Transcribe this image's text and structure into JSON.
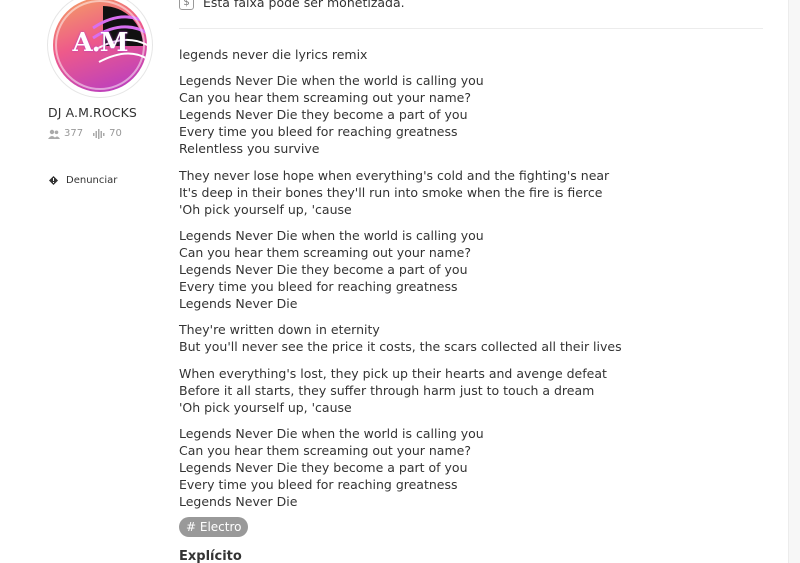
{
  "artist": {
    "avatar_text": "A.M",
    "name": "DJ A.M.ROCKS",
    "followers": "377",
    "tracks": "70",
    "report_label": "Denunciar"
  },
  "monetization": {
    "icon": "$",
    "text": "Esta faixa pode ser monetizada."
  },
  "lyrics": {
    "title": "legends never die lyrics remix",
    "stanzas": [
      [
        "Legends Never Die when the world is calling you",
        "Can you hear them screaming out your name?",
        "Legends Never Die they become a part of you",
        "Every time you bleed for reaching greatness",
        "Relentless you survive"
      ],
      [
        "They never lose hope when everything's cold and the fighting's near",
        "It's deep in their bones they'll run into smoke when the fire is fierce",
        "'Oh pick yourself up, 'cause"
      ],
      [
        "Legends Never Die when the world is calling you",
        "Can you hear them screaming out your name?",
        "Legends Never Die they become a part of you",
        "Every time you bleed for reaching greatness",
        "Legends Never Die"
      ],
      [
        "They're written down in eternity",
        "But you'll never see the price it costs, the scars collected all their lives"
      ],
      [
        "When everything's lost, they pick up their hearts and avenge defeat",
        "Before it all starts, they suffer through harm just to touch a dream",
        "'Oh pick yourself up, 'cause"
      ],
      [
        "Legends Never Die when the world is calling you",
        "Can you hear them screaming out your name?",
        "Legends Never Die they become a part of you",
        "Every time you bleed for reaching greatness",
        "Legends Never Die"
      ]
    ]
  },
  "tag": {
    "label": "# Electro"
  },
  "explicit_label": "Explícito"
}
